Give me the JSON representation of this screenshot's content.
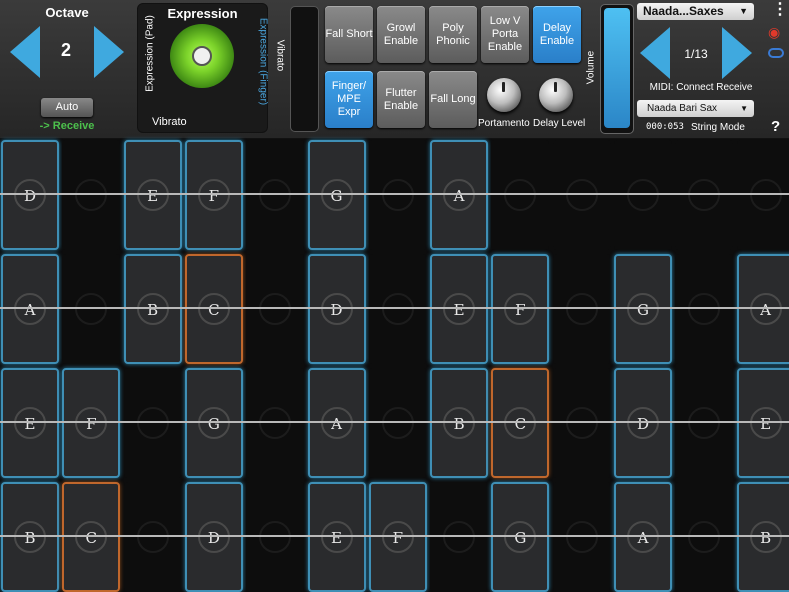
{
  "octave": {
    "title": "Octave",
    "value": "2",
    "auto_label": "Auto",
    "receive_label": "-> Receive"
  },
  "expression": {
    "title": "Expression",
    "pad_label": "Expression (Pad)",
    "finger_label": "Expression (Finger)",
    "vibrato_label": "Vibrato"
  },
  "vibrato_label": "Vibrato",
  "buttons": [
    {
      "label": "Fall Short",
      "on": false
    },
    {
      "label": "Growl Enable",
      "on": false
    },
    {
      "label": "Poly Phonic",
      "on": false
    },
    {
      "label": "Low V Porta Enable",
      "on": false
    },
    {
      "label": "Delay Enable",
      "on": true
    },
    {
      "label": "Finger/ MPE Expr",
      "on": true
    },
    {
      "label": "Flutter Enable",
      "on": false
    },
    {
      "label": "Fall Long",
      "on": false
    }
  ],
  "knobs": {
    "portamento": "Portamento",
    "delay_level": "Delay Level"
  },
  "volume_label": "Volume",
  "preset": {
    "name": "Naada...Saxes",
    "counter": "1/13",
    "midi": "MIDI: Connect Receive",
    "instrument": "Naada Bari Sax",
    "time": "000:053",
    "mode": "String Mode"
  },
  "icons": {
    "menu": "more-vertical-icon",
    "broadcast": "broadcast-icon",
    "cloud": "cloud-icon",
    "help": "?"
  },
  "grid": {
    "rows": [
      [
        "D",
        "",
        "E",
        "F",
        "",
        "G",
        "",
        "A",
        "",
        "",
        "",
        "",
        ""
      ],
      [
        "A",
        "",
        "B",
        "C",
        "",
        "D",
        "",
        "E",
        "F",
        "",
        "G",
        "",
        "A"
      ],
      [
        "E",
        "F",
        "",
        "G",
        "",
        "A",
        "",
        "B",
        "C",
        "",
        "D",
        "",
        "E"
      ],
      [
        "B",
        "C",
        "",
        "D",
        "",
        "E",
        "F",
        "",
        "G",
        "",
        "A",
        "",
        "B"
      ]
    ],
    "highlight_note": "C",
    "colors": {
      "pad_border": "#3f8fb5",
      "highlight_border": "#c0672c",
      "accent": "#3fa9df"
    }
  }
}
